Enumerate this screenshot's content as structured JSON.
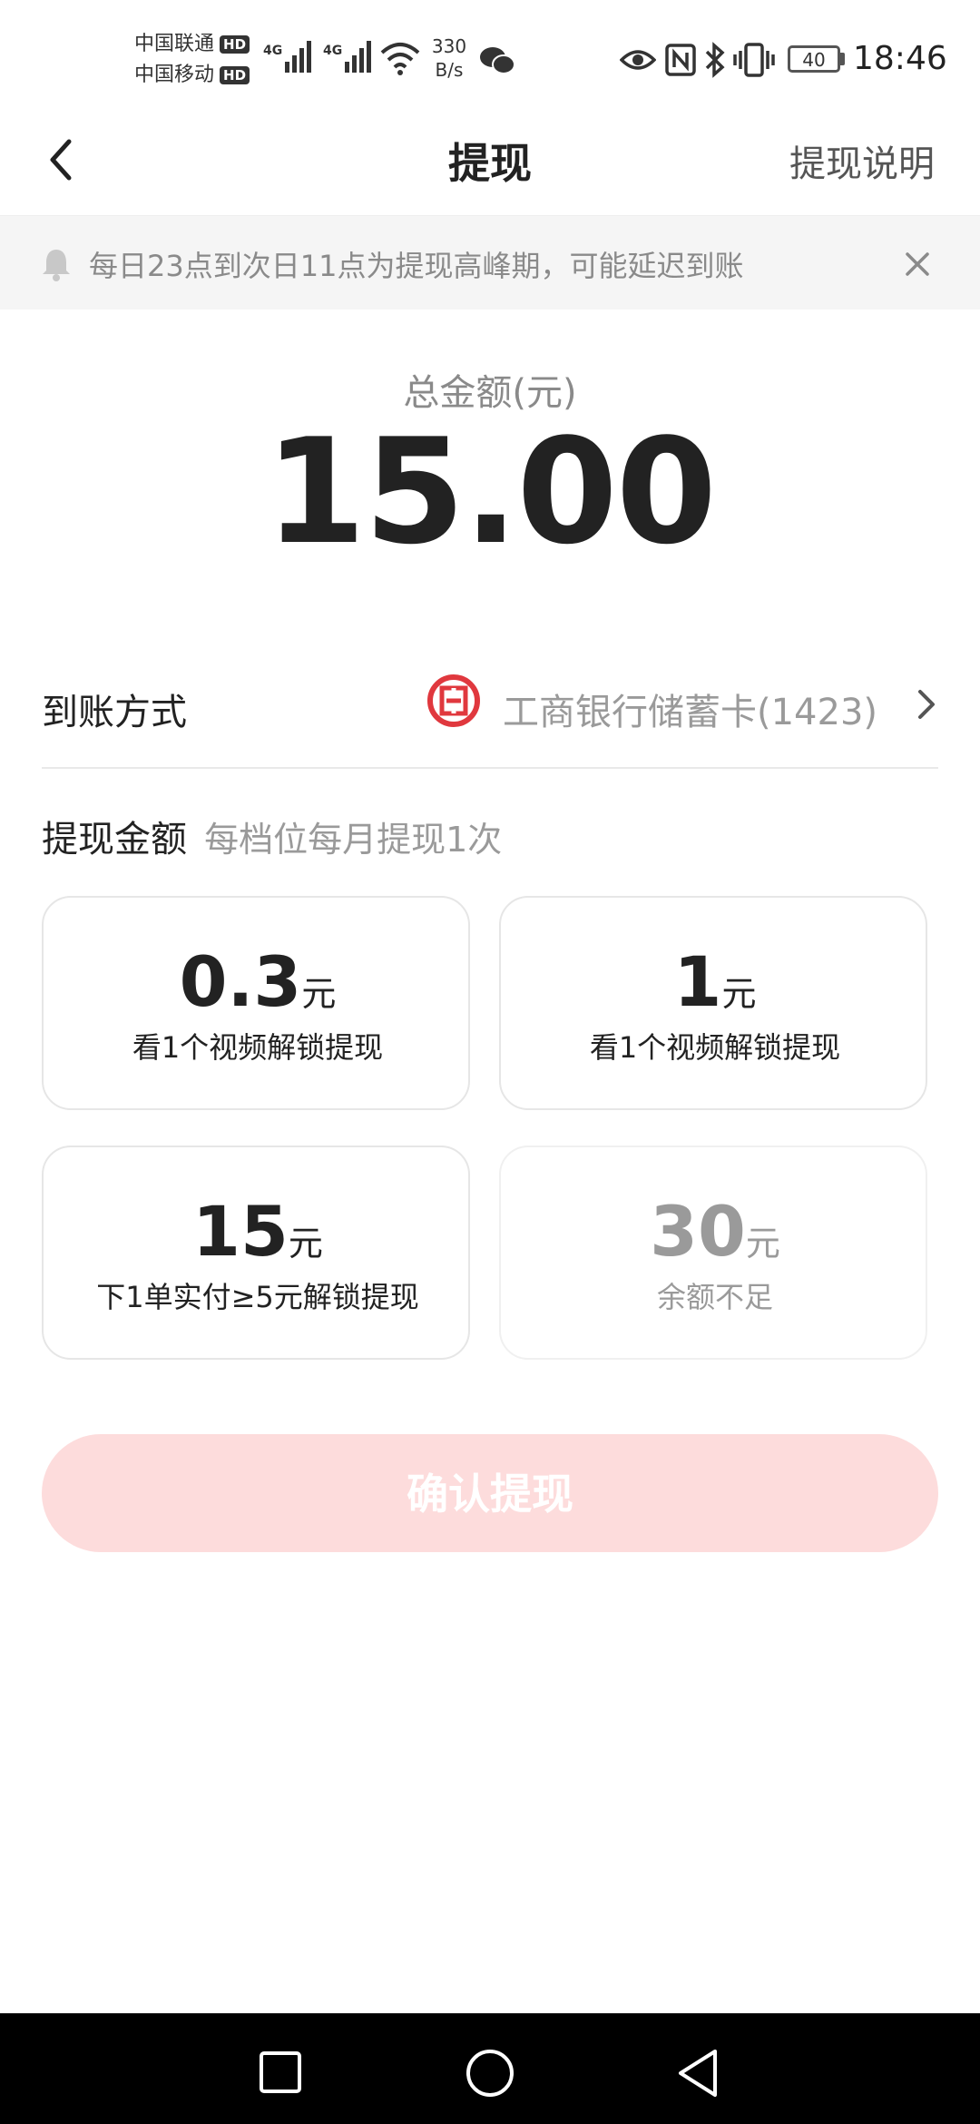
{
  "status_bar": {
    "carrier1": "中国联通",
    "carrier2": "中国移动",
    "hd": "HD",
    "network1": "4G",
    "network2": "4G",
    "speed_value": "330",
    "speed_unit": "B/s",
    "battery": "40",
    "time": "18:46"
  },
  "header": {
    "title": "提现",
    "help_link": "提现说明"
  },
  "notice": {
    "text": "每日23点到次日11点为提现高峰期，可能延迟到账"
  },
  "total": {
    "label": "总金额(元)",
    "value": "15.00"
  },
  "payout_method": {
    "label": "到账方式",
    "bank": "工商银行储蓄卡(1423)",
    "bank_brand_color": "#e0383e"
  },
  "withdraw": {
    "label": "提现金额",
    "hint": "每档位每月提现1次",
    "options": [
      {
        "amount": "0.3",
        "unit": "元",
        "desc": "看1个视频解锁提现"
      },
      {
        "amount": "1",
        "unit": "元",
        "desc": "看1个视频解锁提现"
      },
      {
        "amount": "15",
        "unit": "元",
        "desc": "下1单实付≥5元解锁提现"
      },
      {
        "amount": "30",
        "unit": "元",
        "desc": "余额不足"
      }
    ]
  },
  "confirm_button": {
    "label": "确认提现",
    "background": "#fddcdc"
  },
  "icons": {
    "back": "chevron-left-icon",
    "notice": "bell-icon",
    "close": "close-icon",
    "bank": "icbc-logo-icon",
    "arrow": "chevron-right-icon"
  }
}
